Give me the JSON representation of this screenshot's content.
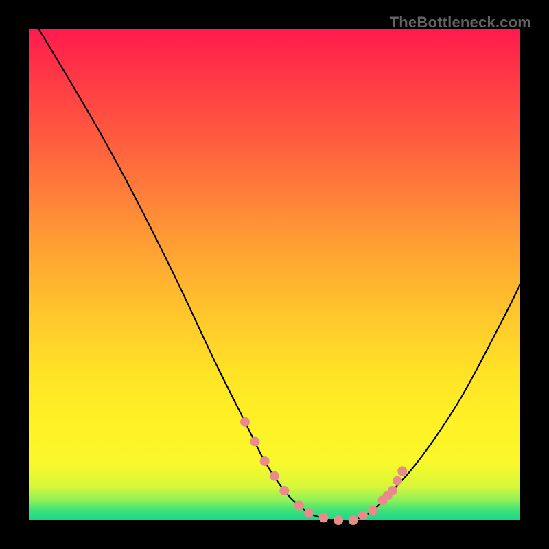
{
  "watermark": "TheBottleneck.com",
  "chart_data": {
    "type": "line",
    "title": "",
    "xlabel": "",
    "ylabel": "",
    "xlim": [
      0,
      100
    ],
    "ylim": [
      0,
      100
    ],
    "grid": false,
    "legend": false,
    "series": [
      {
        "name": "bottleneck-curve",
        "x": [
          2,
          8,
          15,
          22,
          30,
          38,
          44,
          48,
          52,
          55,
          58,
          62,
          66,
          70,
          74,
          80,
          88,
          96,
          100
        ],
        "values": [
          100,
          90,
          78,
          65,
          49,
          32,
          20,
          12,
          6,
          3,
          1,
          0,
          0,
          2,
          6,
          13,
          25,
          40,
          48
        ]
      }
    ],
    "markers": {
      "name": "highlight-dots",
      "color": "#e98b8b",
      "x": [
        44,
        46,
        48,
        50,
        52,
        55,
        57,
        60,
        63,
        66,
        68,
        70,
        72,
        73,
        74,
        75,
        76
      ],
      "values": [
        20,
        16,
        12,
        9,
        6,
        3,
        1.5,
        0.5,
        0,
        0,
        1,
        2,
        4,
        5,
        6,
        8,
        10
      ]
    }
  }
}
